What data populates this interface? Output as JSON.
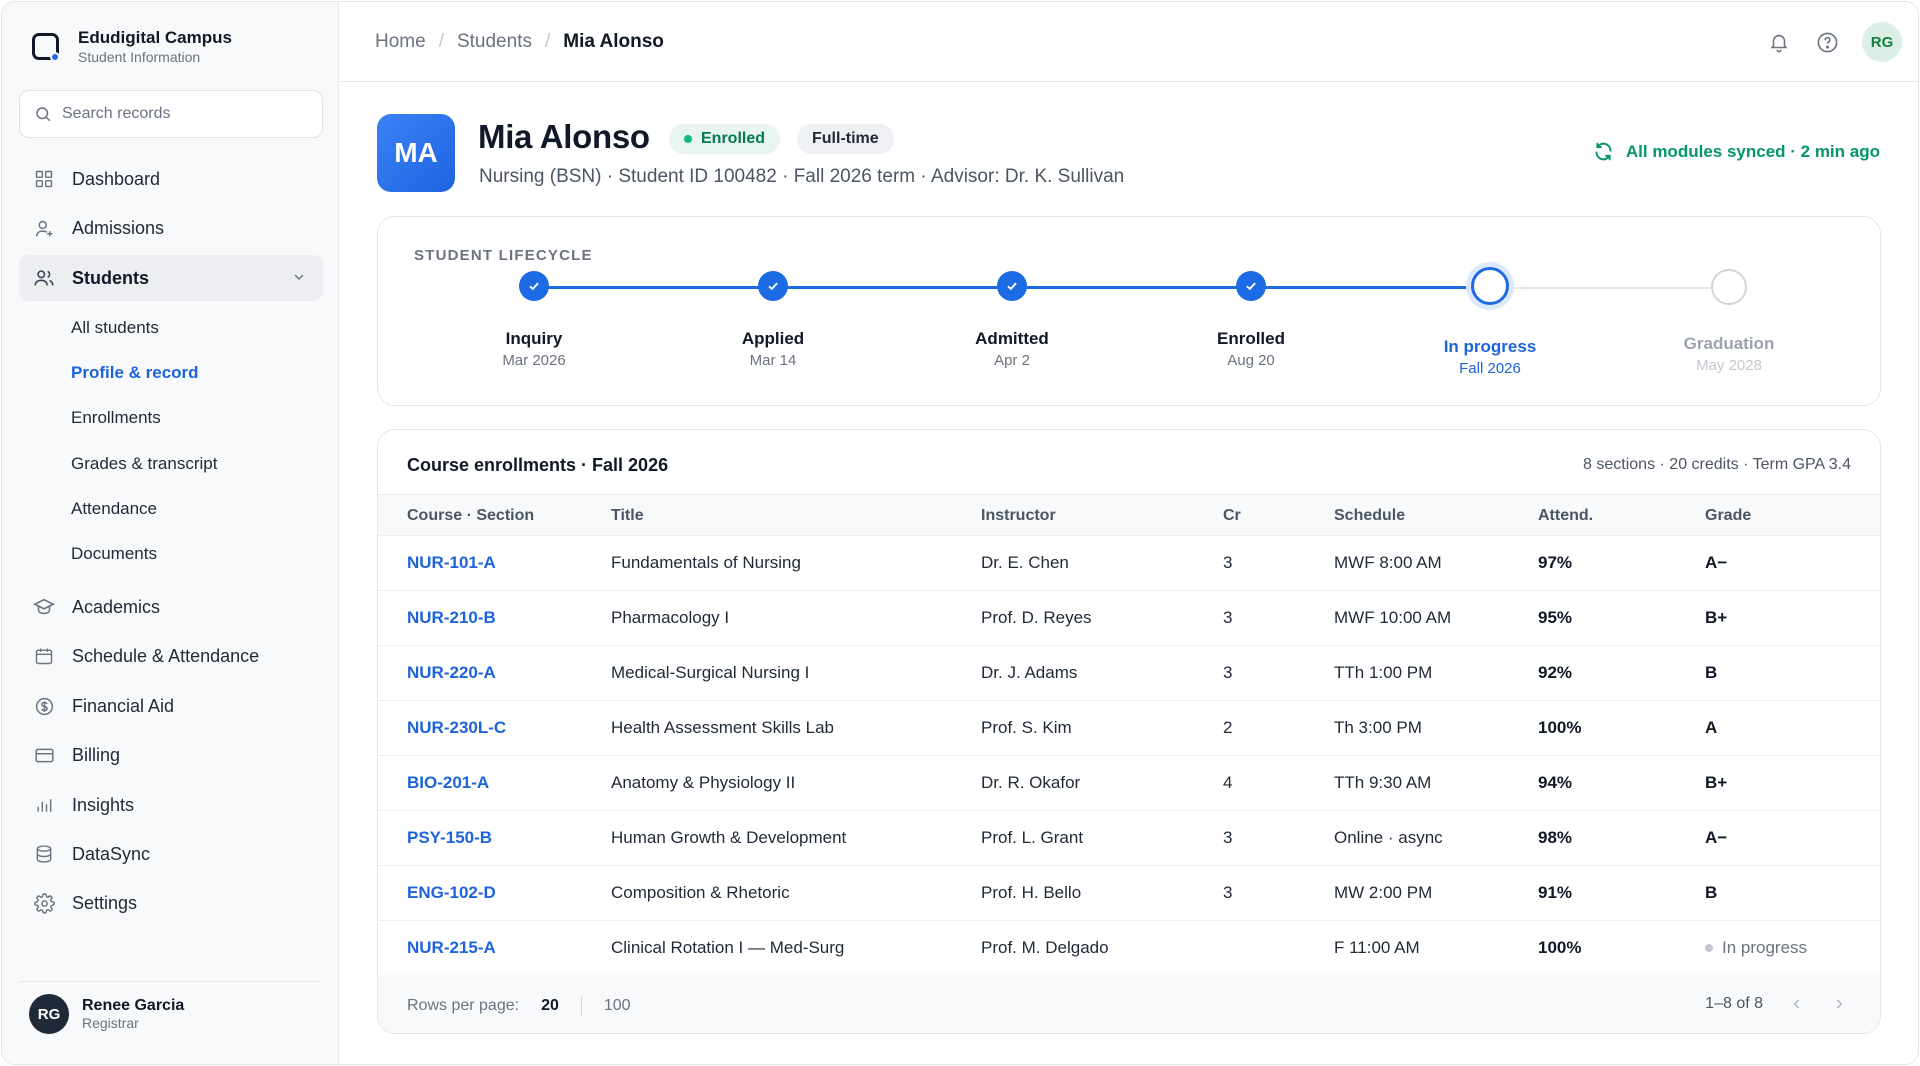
{
  "app": {
    "name": "Edudigital Campus",
    "subtitle": "Student Information"
  },
  "search": {
    "placeholder": "Search records"
  },
  "nav": {
    "items": [
      {
        "label": "Dashboard",
        "icon": "grid-icon"
      },
      {
        "label": "Admissions",
        "icon": "user-plus-icon"
      },
      {
        "label": "Students",
        "icon": "users-icon"
      },
      {
        "label": "Academics",
        "icon": "graduation-cap-icon"
      },
      {
        "label": "Schedule & Attendance",
        "icon": "calendar-icon"
      },
      {
        "label": "Financial Aid",
        "icon": "dollar-circle-icon"
      },
      {
        "label": "Billing",
        "icon": "credit-card-icon"
      },
      {
        "label": "Insights",
        "icon": "bar-chart-icon"
      },
      {
        "label": "DataSync",
        "icon": "database-icon"
      },
      {
        "label": "Settings",
        "icon": "gear-icon"
      }
    ],
    "students_sub": [
      "All students",
      "Profile & record",
      "Enrollments",
      "Grades & transcript",
      "Attendance",
      "Documents"
    ]
  },
  "user": {
    "initials": "RG",
    "name": "Renee Garcia",
    "role": "Registrar"
  },
  "breadcrumb": {
    "home": "Home",
    "students": "Students",
    "current": "Mia Alonso"
  },
  "topbar": {
    "avatar_initials": "RG"
  },
  "profile": {
    "initials": "MA",
    "name": "Mia Alonso",
    "status_badge": "Enrolled",
    "load_badge": "Full-time",
    "meta": "Nursing (BSN) · Student ID 100482 · Fall 2026 term · Advisor: Dr. K. Sullivan",
    "sync_status": "All modules synced · 2 min ago"
  },
  "lifecycle": {
    "title": "STUDENT LIFECYCLE",
    "steps": [
      {
        "label": "Inquiry",
        "date": "Mar 2026",
        "state": "done"
      },
      {
        "label": "Applied",
        "date": "Mar 14",
        "state": "done"
      },
      {
        "label": "Admitted",
        "date": "Apr 2",
        "state": "done"
      },
      {
        "label": "Enrolled",
        "date": "Aug 20",
        "state": "done"
      },
      {
        "label": "In progress",
        "date": "Fall 2026",
        "state": "current"
      },
      {
        "label": "Graduation",
        "date": "May 2028",
        "state": "todo"
      }
    ]
  },
  "enrollments": {
    "title": "Course enrollments · Fall 2026",
    "summary": "8 sections · 20 credits · Term GPA 3.4",
    "columns": [
      "Course · Section",
      "Title",
      "Instructor",
      "Cr",
      "Schedule",
      "Attend.",
      "Grade"
    ],
    "rows": [
      {
        "code": "NUR-101-A",
        "title": "Fundamentals of Nursing",
        "instructor": "Dr. E. Chen",
        "cr": "3",
        "schedule": "MWF 8:00 AM",
        "attend": "97%",
        "grade": "A−"
      },
      {
        "code": "NUR-210-B",
        "title": "Pharmacology I",
        "instructor": "Prof. D. Reyes",
        "cr": "3",
        "schedule": "MWF 10:00 AM",
        "attend": "95%",
        "grade": "B+"
      },
      {
        "code": "NUR-220-A",
        "title": "Medical-Surgical Nursing I",
        "instructor": "Dr. J. Adams",
        "cr": "3",
        "schedule": "TTh 1:00 PM",
        "attend": "92%",
        "grade": "B"
      },
      {
        "code": "NUR-230L-C",
        "title": "Health Assessment Skills Lab",
        "instructor": "Prof. S. Kim",
        "cr": "2",
        "schedule": "Th 3:00 PM",
        "attend": "100%",
        "grade": "A"
      },
      {
        "code": "BIO-201-A",
        "title": "Anatomy & Physiology II",
        "instructor": "Dr. R. Okafor",
        "cr": "4",
        "schedule": "TTh 9:30 AM",
        "attend": "94%",
        "grade": "B+"
      },
      {
        "code": "PSY-150-B",
        "title": "Human Growth & Development",
        "instructor": "Prof. L. Grant",
        "cr": "3",
        "schedule": "Online · async",
        "attend": "98%",
        "grade": "A−"
      },
      {
        "code": "ENG-102-D",
        "title": "Composition & Rhetoric",
        "instructor": "Prof. H. Bello",
        "cr": "3",
        "schedule": "MW 2:00 PM",
        "attend": "91%",
        "grade": "B"
      },
      {
        "code": "NUR-215-A",
        "title": "Clinical Rotation I — Med-Surg",
        "instructor": "Prof. M. Delgado",
        "cr": "",
        "schedule": "F 11:00 AM",
        "attend": "100%",
        "grade": "In progress"
      }
    ],
    "footer": {
      "rows_label": "Rows per page:",
      "options": [
        "20",
        "100"
      ],
      "range": "1–8 of 8"
    }
  },
  "colors": {
    "accent": "#1d6ae5",
    "success": "#059669",
    "sidebar_bg": "#f8f9fa"
  }
}
